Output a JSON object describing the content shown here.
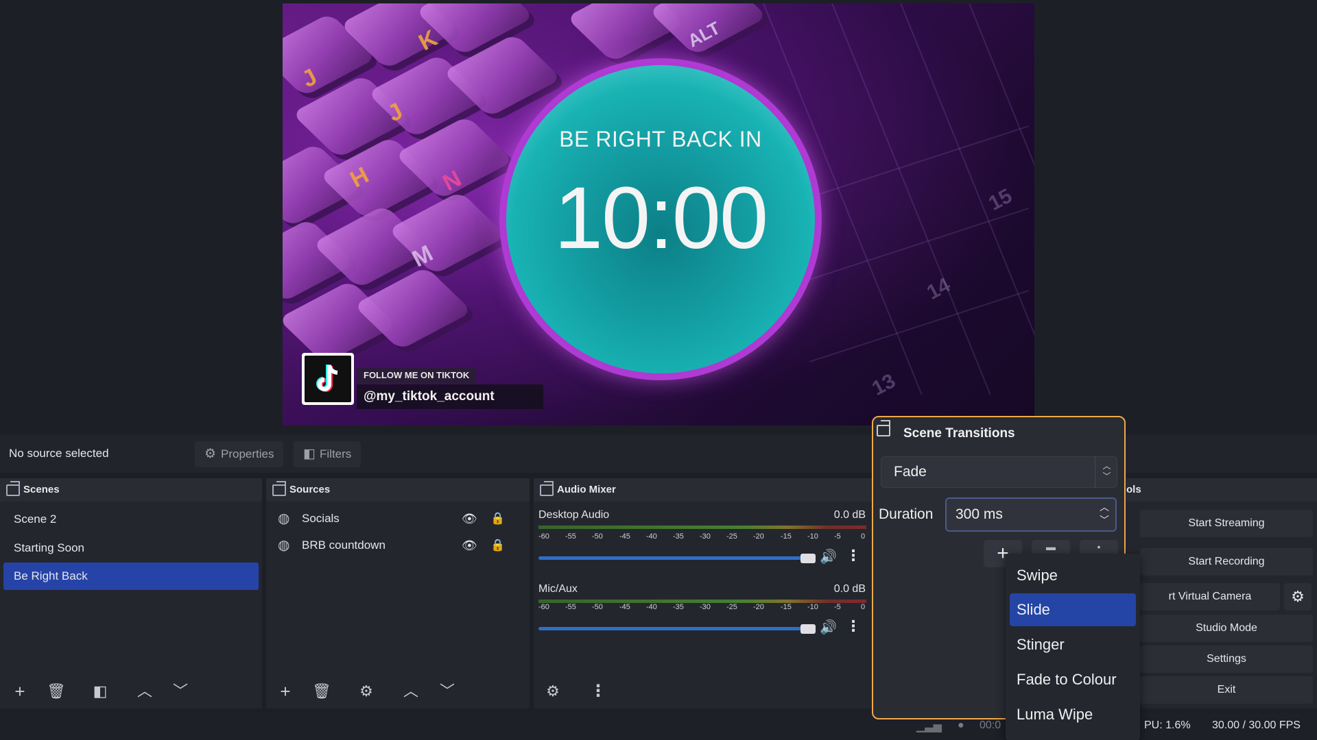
{
  "preview": {
    "brb_text": "BE RIGHT BACK IN",
    "countdown": "10:00",
    "follow_label": "FOLLOW ME ON TIKTOK",
    "handle": "@my_tiktok_account",
    "key_labels": [
      "J",
      "J",
      "K",
      "H",
      "N",
      "M",
      "ALT",
      "15",
      "14",
      "13"
    ]
  },
  "toolbar": {
    "no_source": "No source selected",
    "properties": "Properties",
    "filters": "Filters"
  },
  "scenes": {
    "title": "Scenes",
    "items": [
      {
        "label": "Scene 2"
      },
      {
        "label": "Starting Soon"
      },
      {
        "label": "Be Right Back"
      }
    ],
    "selected_index": 2
  },
  "sources": {
    "title": "Sources",
    "items": [
      {
        "label": "Socials"
      },
      {
        "label": "BRB countdown"
      }
    ]
  },
  "audio_mixer": {
    "title": "Audio Mixer",
    "channels": [
      {
        "name": "Desktop Audio",
        "db": "0.0 dB",
        "volume": 1.0
      },
      {
        "name": "Mic/Aux",
        "db": "0.0 dB",
        "volume": 1.0
      }
    ],
    "ticks": [
      "-60",
      "-55",
      "-50",
      "-45",
      "-40",
      "-35",
      "-30",
      "-25",
      "-20",
      "-15",
      "-10",
      "-5",
      "0"
    ]
  },
  "controls": {
    "title_fragment": "ols",
    "start_streaming": "Start Streaming",
    "start_recording": "Start Recording",
    "virtual_camera": "rt Virtual Camera",
    "studio_mode": "Studio Mode",
    "settings": "Settings",
    "exit": "Exit"
  },
  "scene_transitions": {
    "title": "Scene Transitions",
    "selected": "Fade",
    "duration_label": "Duration",
    "duration_value": "300 ms",
    "options": [
      "Swipe",
      "Slide",
      "Stinger",
      "Fade to Colour",
      "Luma Wipe"
    ],
    "highlighted_index": 1
  },
  "status_bar": {
    "time_fragment": "00:0",
    "cpu": "PU: 1.6%",
    "fps": "30.00 / 30.00 FPS"
  },
  "colors": {
    "accent": "#2644a8",
    "highlight_border": "#f0a94a",
    "background": "#1d1f26"
  }
}
